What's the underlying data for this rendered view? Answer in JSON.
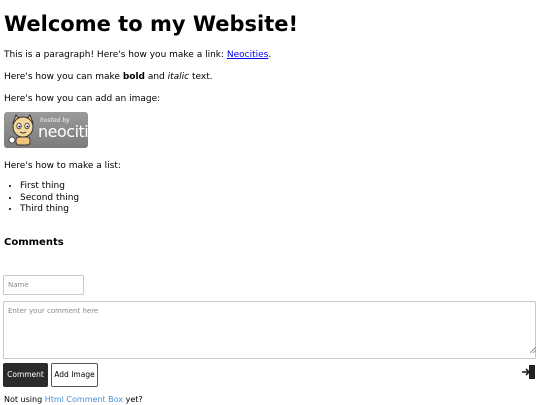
{
  "heading": "Welcome to my Website!",
  "para_link": {
    "prefix": "This is a paragraph! Here's how you make a link: ",
    "link_text": "Neocities",
    "suffix": "."
  },
  "para_format": {
    "prefix": "Here's how you can make ",
    "bold": "bold",
    "middle": " and ",
    "italic": "italic",
    "suffix": " text."
  },
  "para_image": "Here's how you can add an image:",
  "badge": {
    "hosted_by": "hosted by",
    "brand": "neocities"
  },
  "para_list": "Here's how to make a list:",
  "list_items": [
    "First thing",
    "Second thing",
    "Third thing"
  ],
  "comments": {
    "heading": "Comments",
    "name_placeholder": "Name",
    "comment_placeholder": "Enter your comment here",
    "comment_button": "Comment",
    "add_image_button": "Add Image",
    "footer_prefix": "Not using ",
    "footer_link": "Html Comment Box",
    "footer_suffix": "  yet?"
  },
  "colors": {
    "link": "#0000ee",
    "comment_button_bg": "#2b2b2b",
    "footer_link": "#4a90d9"
  },
  "icons": {
    "badge_mascot": "neocities-cat-icon",
    "login": "login-icon",
    "resize": "resize-grip-icon"
  }
}
